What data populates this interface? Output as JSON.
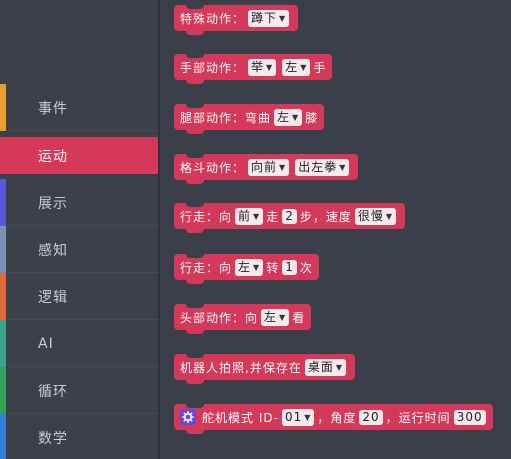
{
  "sidebar": {
    "items": [
      {
        "label": "事件",
        "color": "#e6a02d"
      },
      {
        "label": "运动",
        "color": "#d4395a",
        "active": true
      },
      {
        "label": "展示",
        "color": "#5a57d6"
      },
      {
        "label": "感知",
        "color": "#7c8fb4"
      },
      {
        "label": "逻辑",
        "color": "#e06a3a"
      },
      {
        "label": "AI",
        "color": "#3aa58a"
      },
      {
        "label": "循环",
        "color": "#2fa35a"
      },
      {
        "label": "数学",
        "color": "#3a7fd6"
      }
    ]
  },
  "blocks": {
    "b1": {
      "text": "特殊动作：",
      "dd1": "蹲下"
    },
    "b2": {
      "text": "手部动作：",
      "dd1": "举",
      "dd2": "左",
      "tail": "手"
    },
    "b3": {
      "text": "腿部动作：弯曲",
      "dd1": "左",
      "tail": "膝"
    },
    "b4": {
      "text": "格斗动作：",
      "dd1": "向前",
      "dd2": "出左拳"
    },
    "b5": {
      "text": "行走：向",
      "dd1": "前",
      "mid1": "走",
      "num1": "2",
      "mid2": "步，速度",
      "dd2": "很慢"
    },
    "b6": {
      "text": "行走：向",
      "dd1": "左",
      "mid1": "转",
      "num1": "1",
      "tail": "次"
    },
    "b7": {
      "text": "头部动作：向",
      "dd1": "左",
      "tail": "看"
    },
    "b8": {
      "text": "机器人拍照,并保存在",
      "dd1": "桌面"
    },
    "b9": {
      "text": "舵机模式 ID-",
      "dd1": "01",
      "mid1": "，角度",
      "num1": "20",
      "mid2": "，运行时间",
      "num2": "300"
    }
  },
  "icons": {
    "dropdown": "triangle-down-icon",
    "servo": "gear-icon"
  }
}
